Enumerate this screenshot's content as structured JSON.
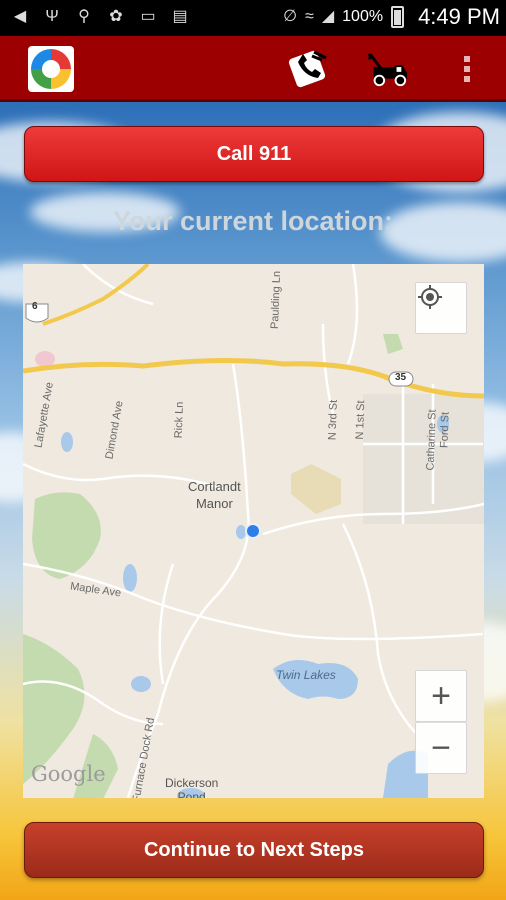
{
  "status_bar": {
    "battery_percent": "100%",
    "time": "4:49 PM",
    "icons": [
      "notification-icon",
      "usb-icon",
      "location-icon",
      "twitter-icon",
      "battery-status-icon",
      "screenshot-icon",
      "mute-icon",
      "wifi-icon",
      "signal-icon",
      "battery-icon"
    ]
  },
  "app_bar": {
    "logo_icon": "lifebuoy-logo-icon",
    "actions": [
      "phone-call-icon",
      "tow-truck-icon",
      "overflow-menu-icon"
    ]
  },
  "main": {
    "call_button_label": "Call 911",
    "location_heading": "Your current location:",
    "continue_button_label": "Continue to Next Steps"
  },
  "map": {
    "labels": {
      "town": "Cortlandt\nManor",
      "lake": "Twin Lakes",
      "maple": "Maple Ave",
      "dickerson": "Dickerson\nPond",
      "route6": "6",
      "route35": "35",
      "lafayette": "Lafayette Ave",
      "dimond": "Dimond Ave",
      "rick": "Rick Ln",
      "paulding": "Paulding Ln",
      "n3rd": "N 3rd St",
      "n1st": "N 1st St",
      "catharine": "Catharine St",
      "ford": "Ford St",
      "furnace": "Furnace Dock Rd"
    },
    "attribution": "Google",
    "zoom_in": "+",
    "zoom_out": "−"
  }
}
